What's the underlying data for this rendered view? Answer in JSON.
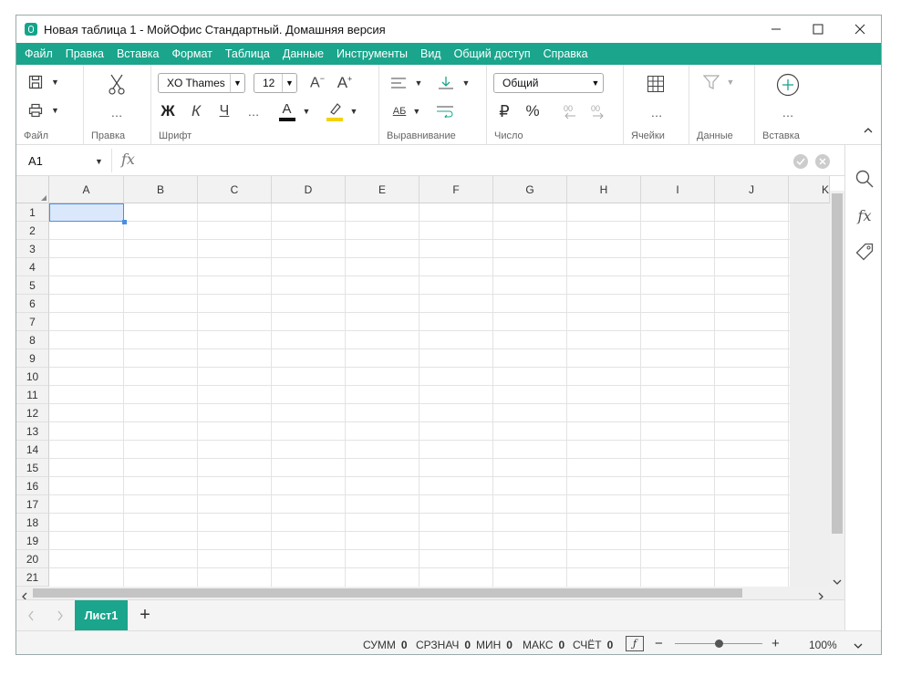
{
  "window": {
    "title": "Новая таблица 1 - МойОфис Стандартный. Домашняя версия"
  },
  "menu": [
    "Файл",
    "Правка",
    "Вставка",
    "Формат",
    "Таблица",
    "Данные",
    "Инструменты",
    "Вид",
    "Общий доступ",
    "Справка"
  ],
  "ribbon": {
    "groups": {
      "file": "Файл",
      "edit": "Правка",
      "font": "Шрифт",
      "align": "Выравнивание",
      "number": "Число",
      "cells": "Ячейки",
      "data": "Данные",
      "insert": "Вставка"
    },
    "font_name": "XO Thames",
    "font_size": "12",
    "number_format": "Общий",
    "bold": "Ж",
    "italic": "К",
    "underline": "Ч",
    "currency": "₽",
    "percent": "%",
    "font_color_letter": "A",
    "wrap_label": "АБ",
    "more": "…"
  },
  "formula_bar": {
    "cell_ref": "A1",
    "fx": "fx",
    "value": ""
  },
  "grid": {
    "columns": [
      "A",
      "B",
      "C",
      "D",
      "E",
      "F",
      "G",
      "H",
      "I",
      "J",
      "K"
    ],
    "rows": [
      "1",
      "2",
      "3",
      "4",
      "5",
      "6",
      "7",
      "8",
      "9",
      "10",
      "11",
      "12",
      "13",
      "14",
      "15",
      "16",
      "17",
      "18",
      "19",
      "20",
      "21"
    ],
    "selected_cell": "A1"
  },
  "sheets": {
    "active": "Лист1",
    "add": "+"
  },
  "status": {
    "sum_label": "СУММ",
    "sum": "0",
    "avg_label": "СРЗНАЧ",
    "avg": "0",
    "min_label": "МИН",
    "min": "0",
    "max_label": "МАКС",
    "max": "0",
    "count_label": "СЧЁТ",
    "count": "0",
    "zoom": "100%",
    "zoom_minus": "−",
    "zoom_plus": "+"
  },
  "colors": {
    "accent": "#1aa58c",
    "selection": "#dbe8fb",
    "selection_border": "#4a8fe0"
  }
}
